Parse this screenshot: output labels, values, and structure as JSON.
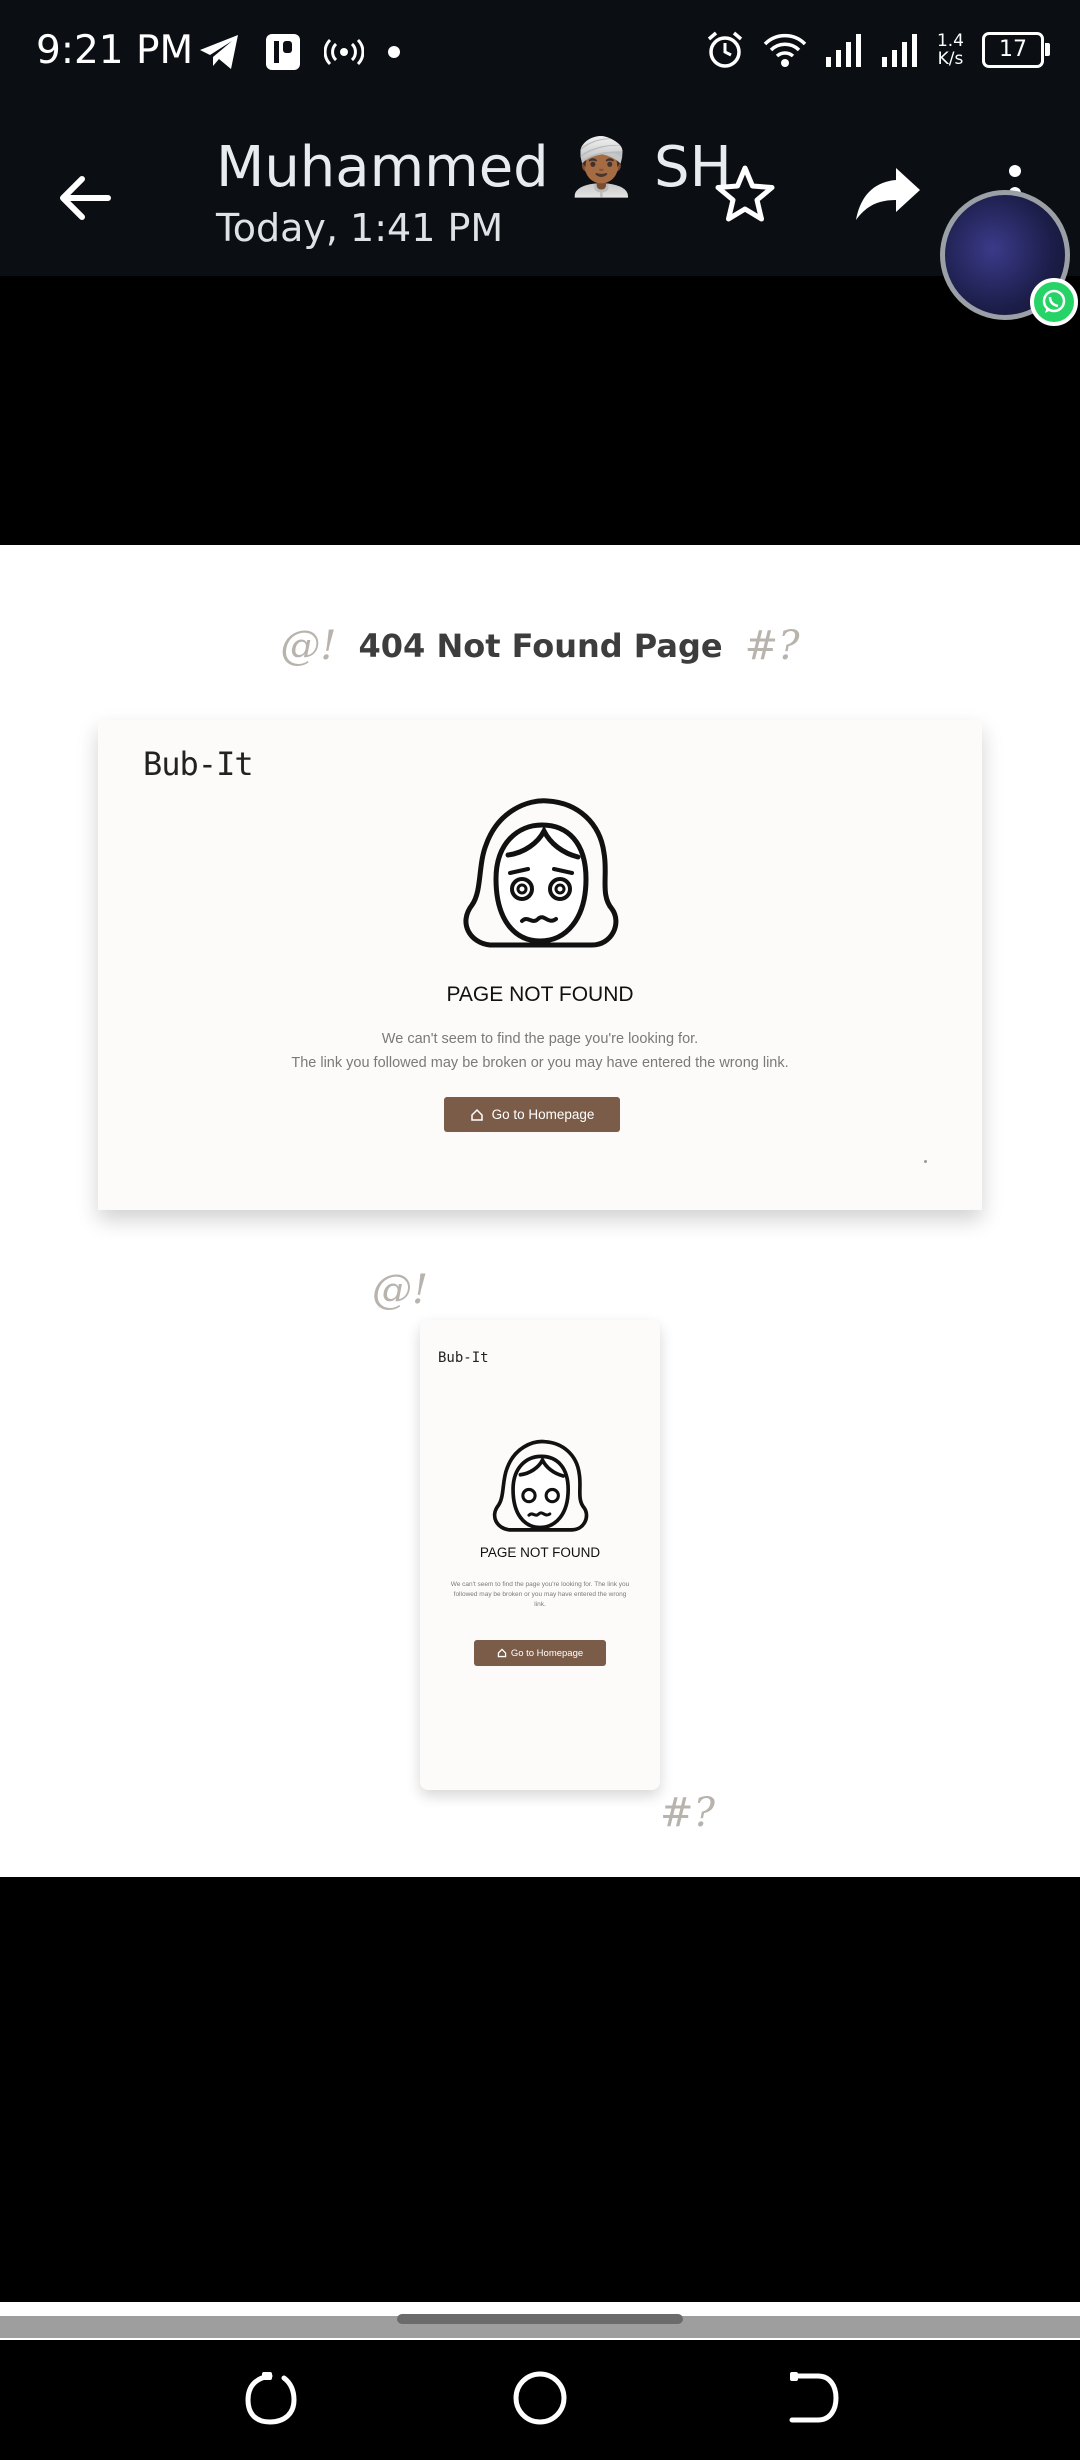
{
  "status_bar": {
    "time": "9:21 PM",
    "net_speed_value": "1.4",
    "net_speed_unit": "K/s",
    "battery": "17"
  },
  "app_bar": {
    "contact_name": "Muhammed 👳🏾‍♂️ SH",
    "timestamp": "Today, 1:41 PM",
    "icons": [
      "back-arrow-icon",
      "star-icon",
      "share-icon",
      "more-vert-icon"
    ]
  },
  "image": {
    "heading": "404 Not Found Page",
    "deco_left": "@!",
    "deco_right": "#?",
    "desktop": {
      "brand": "Bub-It",
      "title": "PAGE NOT FOUND",
      "desc_line1": "We can't seem to find the page you're looking for.",
      "desc_line2": "The link you followed may be broken or you may have entered the wrong link.",
      "button": "Go to Homepage"
    },
    "mobile": {
      "brand": "Bub-It",
      "title": "PAGE NOT FOUND",
      "desc": "We can't seem to find the page you're looking for. The link you followed may be broken or you may have entered the wrong link.",
      "button": "Go to Homepage"
    }
  },
  "colors": {
    "bar_bg": "#0b0f14",
    "button_brown": "#7a5c48",
    "card_bg": "#fcfbf9",
    "whatsapp_green": "#25d366"
  },
  "nav_bar": {
    "icons": [
      "recents-icon",
      "home-icon",
      "back-icon"
    ]
  }
}
